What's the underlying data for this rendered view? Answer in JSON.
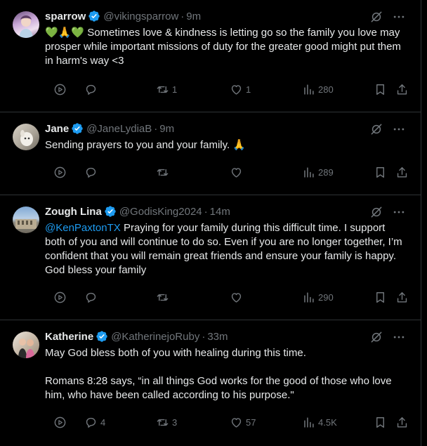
{
  "tweets": [
    {
      "name": "sparrow",
      "handle": "@vikingsparrow",
      "time": "9m",
      "text": "💚🙏💚 Sometimes love & kindness is letting go so the family you love may prosper while important missions of duty for the greater good might put them in harm's way <3",
      "replies": "",
      "retweets": "1",
      "likes": "1",
      "views": "280"
    },
    {
      "name": "Jane",
      "handle": "@JaneLydiaB",
      "time": "9m",
      "text": "Sending prayers to you and your family. 🙏",
      "replies": "",
      "retweets": "",
      "likes": "",
      "views": "289"
    },
    {
      "name": "Zough Lina",
      "handle": "@GodisKing2024",
      "time": "14m",
      "mention": "@KenPaxtonTX",
      "text": " Praying for your family during this difficult time. I support both of you and will continue to do so. Even if you are no longer together, I’m confident that you will remain great friends and ensure your family is happy. God bless your family",
      "replies": "",
      "retweets": "",
      "likes": "",
      "views": "290"
    },
    {
      "name": "Katherine",
      "handle": "@KatherinejoRuby",
      "time": "33m",
      "text": "May God bless both of you with healing during this time.",
      "text2": "Romans 8:28 says, “in all things God works for the good of those who love him, who have been called according to his purpose.\"",
      "replies": "4",
      "retweets": "3",
      "likes": "57",
      "views": "4.5K"
    }
  ],
  "colors": {
    "accent": "#1d9bf0",
    "muted": "#71767b",
    "text": "#e7e9ea",
    "border": "#2f3336",
    "background": "#000000"
  }
}
